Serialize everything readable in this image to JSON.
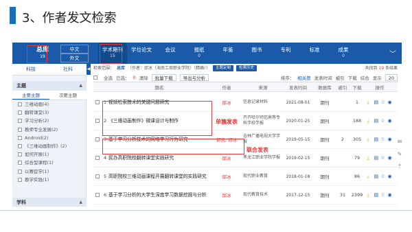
{
  "slide": {
    "title": "3、作者发文检索"
  },
  "nav": {
    "library": {
      "label": "总库",
      "count": "19"
    },
    "lang_zh": "中文",
    "lang_en": "外文",
    "items": [
      {
        "label": "学术期刊",
        "count": "15"
      },
      {
        "label": "学位论文",
        "count": ""
      },
      {
        "label": "会议",
        "count": ""
      },
      {
        "label": "报纸",
        "count": "0"
      },
      {
        "label": "年鉴",
        "count": ""
      },
      {
        "label": "图书",
        "count": ""
      },
      {
        "label": "专利",
        "count": ""
      },
      {
        "label": "标准",
        "count": ""
      },
      {
        "label": "成果",
        "count": "0"
      }
    ],
    "more": "﹀"
  },
  "sidebar": {
    "tabs": [
      "科技",
      "社科"
    ],
    "facet_title": "主题",
    "subtabs": [
      "主要主题",
      "次要主题"
    ],
    "topics": [
      "三维动画(4)",
      "翻转课堂(3)",
      "学习分析(2)",
      "教师专业发展(2)",
      "Android(2)",
      "《三维动画制作》(2)",
      "如何开展(1)",
      "综合型课程(1)",
      "以赛促学(1)",
      "教学实践(1)"
    ],
    "facet2_title": "学科"
  },
  "search": {
    "condition_label": "检索范围：",
    "condition_value": "总库",
    "query": "（作者：邱冰（海南工商职业学院）（精确））",
    "btn_subscribe": "主题定制",
    "btn_history": "检索历史",
    "result_prefix": "共找到",
    "result_count": "19",
    "result_suffix": "条结果"
  },
  "toolbar": {
    "select_all": "全选",
    "selected": "已选：",
    "selected_count": "0",
    "clear": "清除",
    "batch_download": "批量下载",
    "export": "导出与分析",
    "sort_label": "排序：",
    "sort_relevance": "相关度",
    "sort_date": "发表时间",
    "sort_cited": "被引",
    "sort_downloads": "下载",
    "sort_comprehensive": "综合",
    "display": "显示",
    "page_size": "20"
  },
  "table": {
    "headers": [
      "题名",
      "作者",
      "来源",
      "发表时间",
      "数据库",
      "被引",
      "下载",
      "操作"
    ],
    "rows": [
      {
        "no": "1",
        "title": "视频检索技术的关键问题研究",
        "author": "邱冰",
        "source": "信息记录材料",
        "date": "2021-08-01",
        "db": "期刊",
        "cite": "",
        "dl": "1"
      },
      {
        "no": "2",
        "title": "《三维动画制作》微课设计与制作",
        "author": "邱冰",
        "source": "齐齐哈尔师范高等专科学校学报",
        "date": "2020-01-25",
        "db": "期刊",
        "cite": "",
        "dl": "188"
      },
      {
        "no": "3",
        "title": "基于学习分析技术的网络学习行为研究",
        "author": "郭凯; 邱冰",
        "source": "吉林广播电视大学学报",
        "date": "2019-05-15",
        "db": "期刊",
        "cite": "2",
        "dl": "305"
      },
      {
        "no": "4",
        "title": "民办高职院校翻转课堂实践研究",
        "author": "邱冰",
        "source": "黑龙江职业学院学报",
        "date": "2019-02-15",
        "db": "期刊",
        "cite": "",
        "dl": "79"
      },
      {
        "no": "5",
        "title": "高职院校三维动画课程开展翻转课堂的实践研究",
        "author": "邱冰",
        "source": "现代职业教育",
        "date": "2018-01-18",
        "db": "期刊",
        "cite": "",
        "dl": "86"
      },
      {
        "no": "6",
        "title": "基于学习分析的大学生深度学习数据挖掘与分析",
        "author": "邱冰",
        "source": "现代教育技术",
        "date": "2017-12-15",
        "db": "期刊",
        "cite": "31",
        "dl": "2399"
      }
    ]
  },
  "annotations": {
    "single": "单独发表",
    "joint": "联合发表"
  },
  "colors": {
    "nav": "#1a5aa8",
    "annotation": "#e23a3a",
    "author": "#e23a3a"
  }
}
